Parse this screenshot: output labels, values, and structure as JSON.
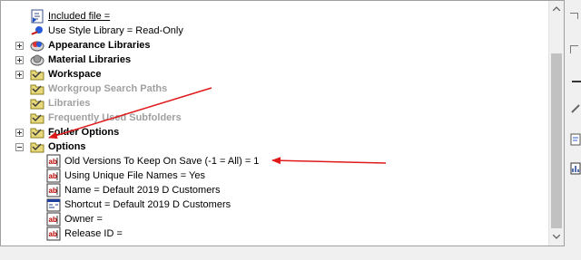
{
  "tree": {
    "items": [
      {
        "label": "Included file ="
      },
      {
        "label": "Use Style Library = Read-Only"
      },
      {
        "label": "Appearance Libraries"
      },
      {
        "label": "Material Libraries"
      },
      {
        "label": "Workspace"
      },
      {
        "label": "Workgroup Search Paths"
      },
      {
        "label": "Libraries"
      },
      {
        "label": "Frequently Used Subfolders"
      },
      {
        "label": "Folder Options"
      },
      {
        "label": "Options"
      },
      {
        "label": "Old Versions To Keep On Save (-1 = All) = 1"
      },
      {
        "label": "Using Unique File Names = Yes"
      },
      {
        "label": "Name = Default 2019 D Customers"
      },
      {
        "label": "Shortcut = Default 2019 D Customers"
      },
      {
        "label": "Owner ="
      },
      {
        "label": "Release ID ="
      }
    ]
  },
  "icons": {
    "abc_field": "abc-field-icon",
    "folder": "folder-icon",
    "library": "library-icon",
    "shortcut": "shortcut-icon",
    "style": "style-library-icon"
  },
  "colors": {
    "annotation_arrow": "#e0191b",
    "disabled_text": "#a0a0a0"
  }
}
